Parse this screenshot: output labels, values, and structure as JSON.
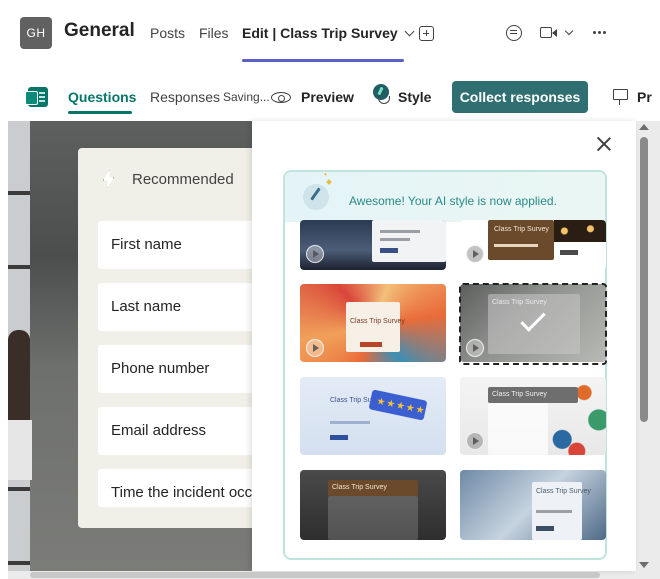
{
  "header": {
    "avatar_initials": "GH",
    "channel_title": "General",
    "tabs": [
      {
        "label": "Posts"
      },
      {
        "label": "Files"
      },
      {
        "label": "Edit | Class Trip Survey"
      }
    ]
  },
  "forms_toolbar": {
    "tabs": [
      {
        "label": "Questions"
      },
      {
        "label": "Responses"
      }
    ],
    "saving_status": "Saving...",
    "preview_label": "Preview",
    "style_label": "Style",
    "collect_label": "Collect responses",
    "present_label": "Pr"
  },
  "form": {
    "section_label": "Recommended",
    "fields": [
      {
        "label": "First name"
      },
      {
        "label": "Last name"
      },
      {
        "label": "Phone number"
      },
      {
        "label": "Email address"
      },
      {
        "label": "Time the incident occurred"
      }
    ]
  },
  "style_panel": {
    "ai_message": "Awesome! Your AI style is now applied.",
    "themes": [
      {
        "title": ""
      },
      {
        "title": "Class Trip Survey"
      },
      {
        "title": "Class Trip Survey"
      },
      {
        "title": "Class Trip Survey",
        "selected": true
      },
      {
        "title": "Class Trip Survey"
      },
      {
        "title": "Class Trip Survey"
      },
      {
        "title": "Class Trip Survey"
      },
      {
        "title": "Class Trip Survey"
      }
    ]
  },
  "colors": {
    "teams_accent": "#5b5fc7",
    "forms_accent": "#077568",
    "collect_button": "#2f6f72",
    "ai_text": "#2a8a86"
  },
  "icons": [
    "more-options-icon",
    "chat-icon",
    "video-call-icon",
    "add-tab-icon",
    "forms-logo-icon",
    "preview-eye-icon",
    "style-palette-icon",
    "present-icon",
    "lightning-icon",
    "close-icon",
    "ai-wand-icon",
    "checkmark-icon",
    "play-icon"
  ]
}
